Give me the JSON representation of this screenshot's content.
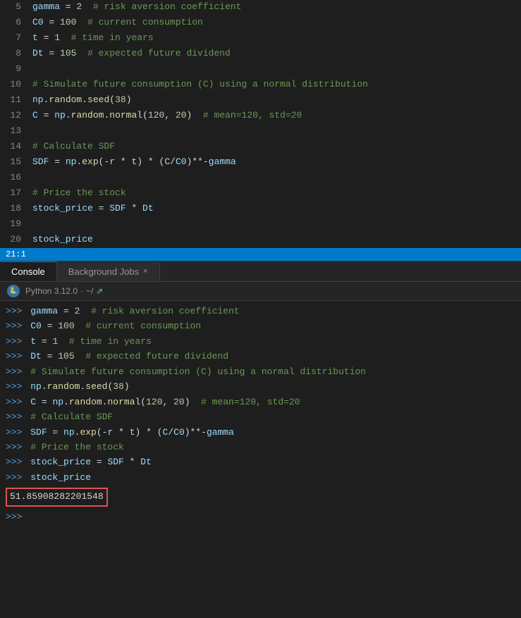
{
  "editor": {
    "lines": [
      {
        "num": 5,
        "tokens": [
          {
            "t": "var",
            "v": "gamma"
          },
          {
            "t": "op",
            "v": " = "
          },
          {
            "t": "num",
            "v": "2"
          },
          {
            "t": "cm",
            "v": "  # risk aversion coefficient"
          }
        ]
      },
      {
        "num": 6,
        "tokens": [
          {
            "t": "var",
            "v": "C0"
          },
          {
            "t": "op",
            "v": " = "
          },
          {
            "t": "num",
            "v": "100"
          },
          {
            "t": "cm",
            "v": "  # current consumption"
          }
        ]
      },
      {
        "num": 7,
        "tokens": [
          {
            "t": "var",
            "v": "t"
          },
          {
            "t": "op",
            "v": " = "
          },
          {
            "t": "num",
            "v": "1"
          },
          {
            "t": "cm",
            "v": "  # time in years"
          }
        ]
      },
      {
        "num": 8,
        "tokens": [
          {
            "t": "var",
            "v": "Dt"
          },
          {
            "t": "op",
            "v": " = "
          },
          {
            "t": "num",
            "v": "105"
          },
          {
            "t": "cm",
            "v": "  # expected future dividend"
          }
        ]
      },
      {
        "num": 9,
        "tokens": []
      },
      {
        "num": 10,
        "tokens": [
          {
            "t": "cm",
            "v": "# Simulate future consumption (C) using a normal distribution"
          }
        ]
      },
      {
        "num": 11,
        "tokens": [
          {
            "t": "var",
            "v": "np"
          },
          {
            "t": "op",
            "v": "."
          },
          {
            "t": "fn",
            "v": "random"
          },
          {
            "t": "op",
            "v": "."
          },
          {
            "t": "fn",
            "v": "seed"
          },
          {
            "t": "pn",
            "v": "("
          },
          {
            "t": "num",
            "v": "38"
          },
          {
            "t": "pn",
            "v": ")"
          }
        ]
      },
      {
        "num": 12,
        "tokens": [
          {
            "t": "var",
            "v": "C"
          },
          {
            "t": "op",
            "v": " = "
          },
          {
            "t": "var",
            "v": "np"
          },
          {
            "t": "op",
            "v": "."
          },
          {
            "t": "fn",
            "v": "random"
          },
          {
            "t": "op",
            "v": "."
          },
          {
            "t": "fn",
            "v": "normal"
          },
          {
            "t": "pn",
            "v": "("
          },
          {
            "t": "num",
            "v": "120"
          },
          {
            "t": "pn",
            "v": ", "
          },
          {
            "t": "num",
            "v": "20"
          },
          {
            "t": "pn",
            "v": ")"
          },
          {
            "t": "cm",
            "v": "  # mean=120, std=20"
          }
        ]
      },
      {
        "num": 13,
        "tokens": []
      },
      {
        "num": 14,
        "tokens": [
          {
            "t": "cm",
            "v": "# Calculate SDF"
          }
        ]
      },
      {
        "num": 15,
        "tokens": [
          {
            "t": "var",
            "v": "SDF"
          },
          {
            "t": "op",
            "v": " = "
          },
          {
            "t": "var",
            "v": "np"
          },
          {
            "t": "op",
            "v": "."
          },
          {
            "t": "fn",
            "v": "exp"
          },
          {
            "t": "pn",
            "v": "("
          },
          {
            "t": "op",
            "v": "-"
          },
          {
            "t": "var",
            "v": "r"
          },
          {
            "t": "op",
            "v": " * "
          },
          {
            "t": "var",
            "v": "t"
          },
          {
            "t": "pn",
            "v": ")"
          },
          {
            "t": "op",
            "v": " * "
          },
          {
            "t": "pn",
            "v": "("
          },
          {
            "t": "var",
            "v": "C"
          },
          {
            "t": "op",
            "v": "/"
          },
          {
            "t": "var",
            "v": "C0"
          },
          {
            "t": "pn",
            "v": ")"
          },
          {
            "t": "op",
            "v": "**"
          },
          {
            "t": "op",
            "v": "-"
          },
          {
            "t": "var",
            "v": "gamma"
          }
        ]
      },
      {
        "num": 16,
        "tokens": []
      },
      {
        "num": 17,
        "tokens": [
          {
            "t": "cm",
            "v": "# Price the stock"
          }
        ]
      },
      {
        "num": 18,
        "tokens": [
          {
            "t": "var",
            "v": "stock_price"
          },
          {
            "t": "op",
            "v": " = "
          },
          {
            "t": "var",
            "v": "SDF"
          },
          {
            "t": "op",
            "v": " * "
          },
          {
            "t": "var",
            "v": "Dt"
          }
        ]
      },
      {
        "num": 19,
        "tokens": []
      },
      {
        "num": 20,
        "tokens": [
          {
            "t": "var",
            "v": "stock_price"
          }
        ]
      }
    ],
    "status": "21:1"
  },
  "tabs": [
    {
      "id": "console",
      "label": "Console",
      "active": true,
      "closeable": false
    },
    {
      "id": "background-jobs",
      "label": "Background Jobs",
      "active": false,
      "closeable": true
    }
  ],
  "console": {
    "python_version": "Python 3.12.0",
    "path": "~/",
    "lines": [
      {
        "type": "input",
        "text": "gamma = 2  # risk aversion coefficient"
      },
      {
        "type": "input",
        "text": "C0 = 100  # current consumption"
      },
      {
        "type": "input",
        "text": "t = 1  # time in years"
      },
      {
        "type": "input",
        "text": "Dt = 105  # expected future dividend"
      },
      {
        "type": "input",
        "text": "# Simulate future consumption (C) using a normal distribution"
      },
      {
        "type": "input",
        "text": "np.random.seed(38)"
      },
      {
        "type": "input",
        "text": "C = np.random.normal(120, 20)  # mean=120, std=20"
      },
      {
        "type": "input",
        "text": "# Calculate SDF"
      },
      {
        "type": "input",
        "text": "SDF = np.exp(-r * t) * (C/C0)**-gamma"
      },
      {
        "type": "input",
        "text": "# Price the stock"
      },
      {
        "type": "input",
        "text": "stock_price = SDF * Dt"
      },
      {
        "type": "input",
        "text": "stock_price"
      },
      {
        "type": "result",
        "text": "51.85908282201548"
      },
      {
        "type": "empty",
        "text": ""
      }
    ]
  }
}
